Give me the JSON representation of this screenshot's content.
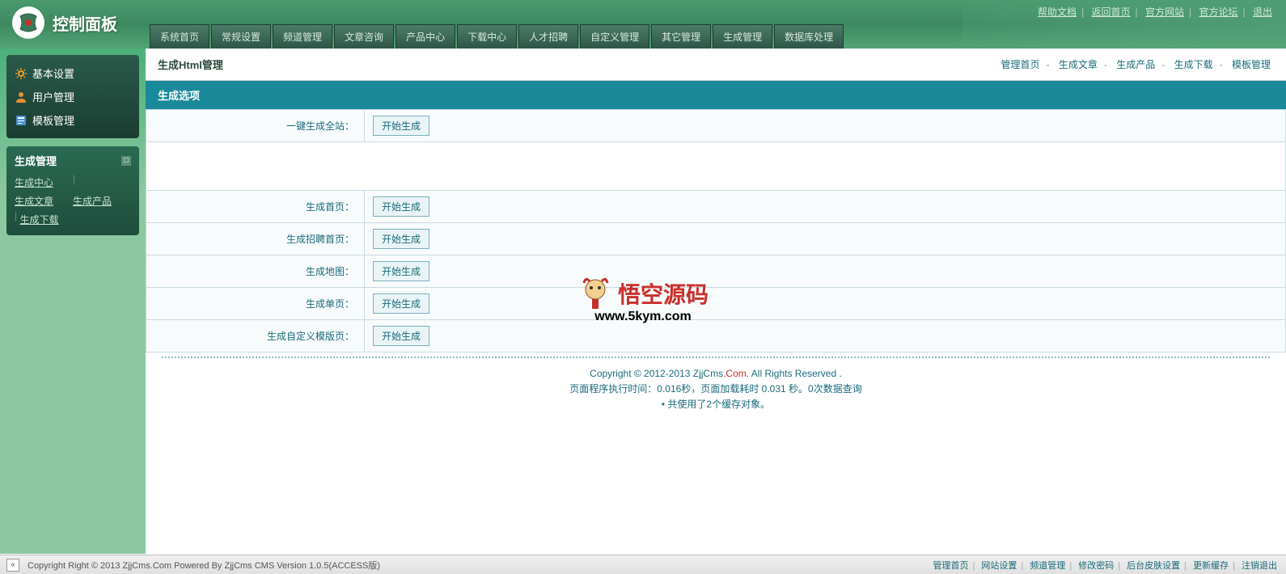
{
  "header": {
    "logo_text": "控制面板",
    "top_links": [
      "帮助文档",
      "返回首页",
      "官方网站",
      "官方论坛",
      "退出"
    ],
    "main_menu": [
      "系统首页",
      "常规设置",
      "频道管理",
      "文章咨询",
      "产品中心",
      "下载中心",
      "人才招聘",
      "自定义管理",
      "其它管理",
      "生成管理",
      "数据库处理"
    ]
  },
  "sidebar": {
    "panel1": [
      {
        "icon": "gear",
        "label": "基本设置"
      },
      {
        "icon": "user",
        "label": "用户管理"
      },
      {
        "icon": "template",
        "label": "模板管理"
      }
    ],
    "panel2_title": "生成管理",
    "panel2_links": [
      "生成中心",
      "生成文章",
      "生成产品",
      "生成下载"
    ]
  },
  "breadcrumb": {
    "title": "生成Html管理",
    "links": [
      "管理首页",
      "生成文章",
      "生成产品",
      "生成下载",
      "模板管理"
    ]
  },
  "section_header": "生成选项",
  "rows": [
    {
      "label": "一键生成全站：",
      "btn": "开始生成"
    },
    {
      "label": "生成首页：",
      "btn": "开始生成"
    },
    {
      "label": "生成招聘首页：",
      "btn": "开始生成"
    },
    {
      "label": "生成地图：",
      "btn": "开始生成"
    },
    {
      "label": "生成单页：",
      "btn": "开始生成"
    },
    {
      "label": "生成自定义模版页：",
      "btn": "开始生成"
    }
  ],
  "watermark": {
    "text": "悟空源码",
    "url": "www.5kym.com"
  },
  "footer_info": {
    "line1_a": "Copyright © 2012-2013 ",
    "line1_b": "ZjjCms",
    "line1_c": ".Com",
    "line1_d": ". All Rights Reserved .",
    "line2": "页面程序执行时间：0.016秒，页面加载耗时 0.031 秒。0次数据查询",
    "line3": "• 共使用了2个缓存对象。"
  },
  "bottombar": {
    "copyright": "Copyright Right © 2013 ZjjCms.Com Powered By ZjjCms CMS Version 1.0.5(ACCESS版)",
    "links": [
      "管理首页",
      "网站设置",
      "频道管理",
      "修改密码",
      "后台皮肤设置",
      "更新缓存",
      "注销退出"
    ]
  }
}
